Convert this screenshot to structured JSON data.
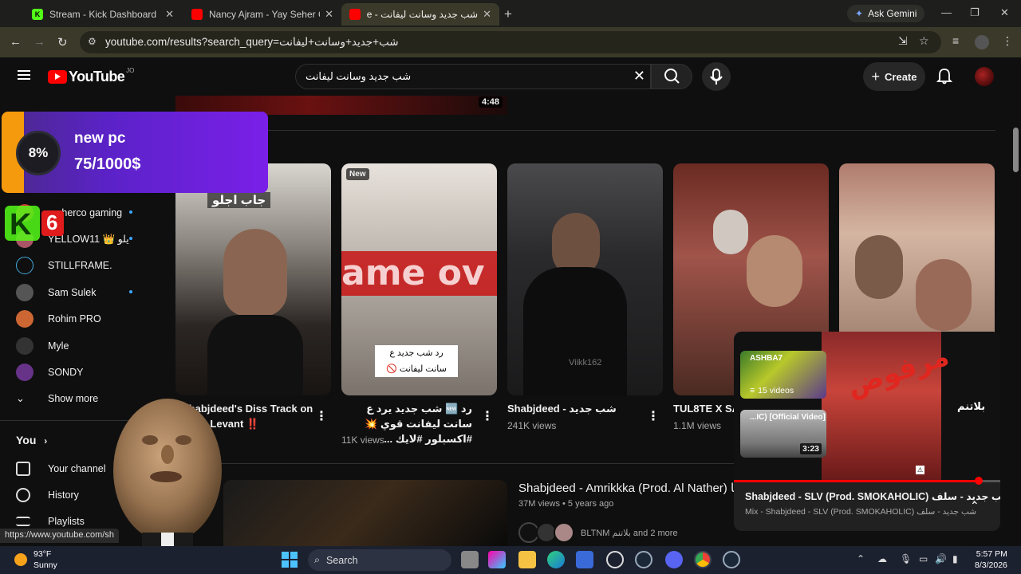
{
  "browser": {
    "tabs": [
      {
        "title": "Stream - Kick Dashboard",
        "active": false
      },
      {
        "title": "Nancy Ajram - Yay Seher Oyoun",
        "active": false
      },
      {
        "title": "شب جديد وسانت ليفانت - YouTube",
        "active": true
      }
    ],
    "gemini_label": "Ask Gemini",
    "url": "youtube.com/results?search_query=شب+جديد+وسانت+ليفانت"
  },
  "youtube": {
    "logo_text": "YouTube",
    "country_code": "JO",
    "search_value": "شب جديد وسانت ليفانت",
    "create_label": "Create"
  },
  "sidebar": {
    "subscriptions": [
      {
        "name": "maherco gaming",
        "dot": true
      },
      {
        "name": "YELLOW11 👑 يلو",
        "dot": true
      },
      {
        "name": "STILLFRAME.",
        "dot": false
      },
      {
        "name": "Sam Sulek",
        "dot": true
      },
      {
        "name": "Rohim PRO",
        "dot": false
      },
      {
        "name": "Myle",
        "dot": false
      },
      {
        "name": "SONDY",
        "dot": false
      }
    ],
    "show_more": "Show more",
    "you_heading": "You",
    "you_items": [
      "Your channel",
      "History",
      "Playlists"
    ]
  },
  "content": {
    "top_duration": "4:48",
    "shorts": [
      {
        "title": "Shabjdeed's Diss Track on Saint Levant ‼️",
        "views": "",
        "badge": "",
        "overlay": "جاب اجلو"
      },
      {
        "title": "رد 🆕 شب جديد يرد ع سانت ليفانت قوي 💥 #اكسبلور #لايك ...",
        "views": "11K views",
        "badge": "New",
        "overlay": "رد شب جديد ع سانت ليفانت 🚫"
      },
      {
        "title": "Shabjdeed - شب جديد",
        "views": "241K views",
        "badge": "",
        "overlay": "Viikk162"
      },
      {
        "title": "TUL8TE X SA...",
        "views": "1.1M views",
        "badge": "",
        "overlay": ""
      },
      {
        "title": "",
        "views": "",
        "badge": "",
        "overlay": ""
      }
    ],
    "video": {
      "title": "Shabjdeed - Amrikkka (Prod. Al Nather) كا",
      "meta": "37M views • 5 years ago",
      "channels": "BLTNM بلاتنم and 2 more"
    }
  },
  "overlay": {
    "goal_percent": "8%",
    "goal_percent_value": 0.08,
    "goal_label": "new pc",
    "goal_amount": "75/1000$",
    "kick_count": "6"
  },
  "miniplayer": {
    "title": "Shabjdeed - SLV (Prod. SMOKAHOLIC) شب جديد - سلف ...",
    "subtitle": "Mix - Shabjdeed - SLV (Prod. SMOKAHOLIC) شب جديد - سلف",
    "card1_top": "ASHBA7",
    "card1_label": "15 videos",
    "card2_top": "...IC) [Official Video]",
    "card2_duration": "3:23",
    "progress": 0.92,
    "logo": "بلاتنم"
  },
  "status_url": "https://www.youtube.com/sh",
  "taskbar": {
    "temp": "93°F",
    "condition": "Sunny",
    "search_label": "Search",
    "time": "5:57 PM",
    "date": "8/3/2026"
  },
  "colors": {
    "youtube_red": "#ff0000",
    "goal_purple": "#6a22d8",
    "goal_orange": "#f59a0c",
    "kick_green": "#53fc18"
  }
}
